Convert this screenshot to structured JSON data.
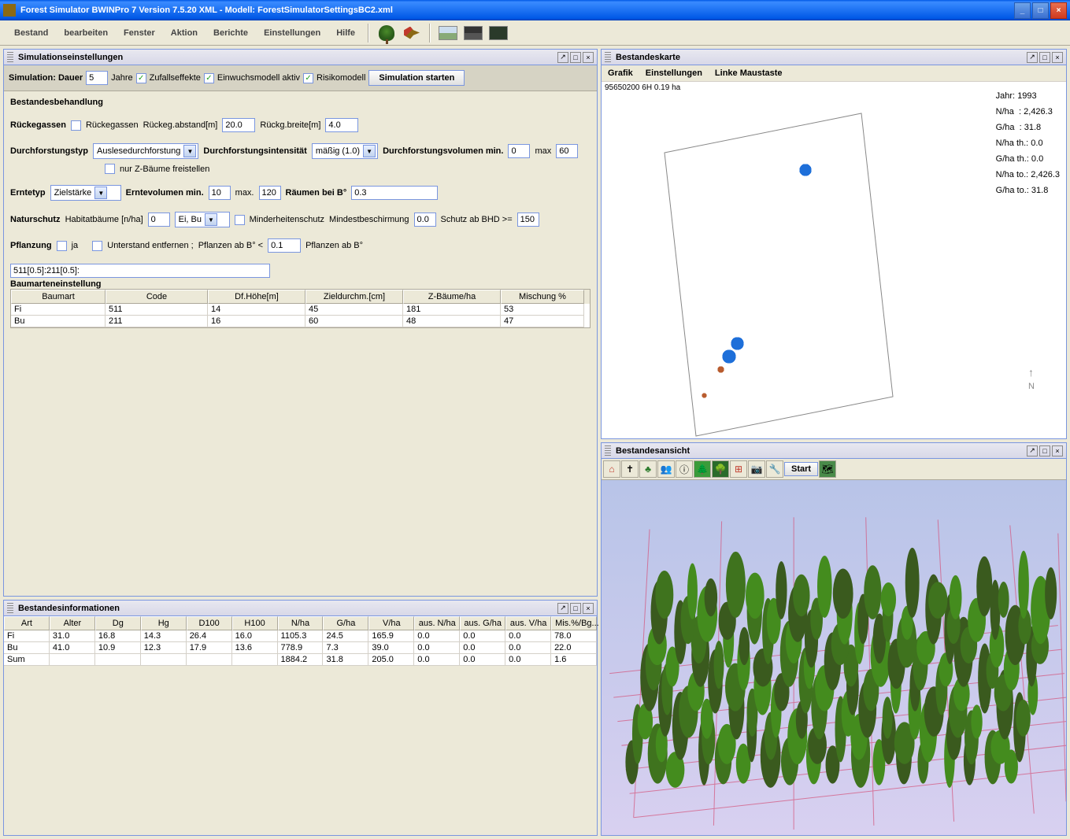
{
  "window": {
    "title": "Forest Simulator BWINPro 7 Version 7.5.20 XML - Modell: ForestSimulatorSettingsBC2.xml"
  },
  "menu": {
    "items": [
      "Bestand",
      "bearbeiten",
      "Fenster",
      "Aktion",
      "Berichte",
      "Einstellungen",
      "Hilfe"
    ]
  },
  "panels": {
    "settings": {
      "title": "Simulationseinstellungen"
    },
    "info": {
      "title": "Bestandesinformationen"
    },
    "map": {
      "title": "Bestandeskarte"
    },
    "view": {
      "title": "Bestandesansicht"
    }
  },
  "sim": {
    "duration_label": "Simulation: Dauer",
    "duration": "5",
    "years": "Jahre",
    "random_label": "Zufallseffekte",
    "ingrowth_label": "Einwuchsmodell aktiv",
    "risk_label": "Risikomodell",
    "start_btn": "Simulation starten"
  },
  "treatment": {
    "heading": "Bestandesbehandlung",
    "skid_label": "Rückegassen",
    "skid_chk": "Rückegassen",
    "skid_dist_label": "Rückeg.abstand[m]",
    "skid_dist": "20.0",
    "skid_width_label": "Rückg.breite[m]",
    "skid_width": "4.0",
    "thin_type_label": "Durchforstungstyp",
    "thin_type": "Auslesedurchforstung",
    "thin_int_label": "Durchforstungsintensität",
    "thin_int": "mäßig (1.0)",
    "thin_vol_label": "Durchforstungsvolumen min.",
    "thin_vol_min": "0",
    "thin_vol_max_label": "max",
    "thin_vol_max": "60",
    "only_z_label": "nur Z-Bäume freistellen",
    "harvest_type_label": "Erntetyp",
    "harvest_type": "Zielstärke",
    "harvest_vol_label": "Erntevolumen min.",
    "harvest_vol_min": "10",
    "harvest_vol_max_label": "max.",
    "harvest_vol_max": "120",
    "clear_label": "Räumen bei B°",
    "clear_val": "0.3",
    "nature_label": "Naturschutz",
    "habitat_label": "Habitatbäume [n/ha]",
    "habitat_val": "0",
    "species_sel": "Ei, Bu",
    "minority_label": "Minderheitenschutz",
    "cover_label": "Mindestbeschirmung",
    "cover_val": "0.0",
    "protect_label": "Schutz ab BHD >=",
    "protect_val": "150",
    "plant_label": "Pflanzung",
    "plant_yes": "ja",
    "understory_label": "Unterstand entfernen ;",
    "plant_from_label": "Pflanzen ab B°  <",
    "plant_from_val": "0.1",
    "plant_from2_label": "Pflanzen ab B°",
    "plant_code": "511[0.5]:211[0.5]:",
    "species_heading": "Baumarteneinstellung"
  },
  "species_table": {
    "headers": [
      "Baumart",
      "Code",
      "Df.Höhe[m]",
      "Zieldurchm.[cm]",
      "Z-Bäume/ha",
      "Mischung %"
    ],
    "rows": [
      [
        "Fi",
        "511",
        "14",
        "45",
        "181",
        "53"
      ],
      [
        "Bu",
        "211",
        "16",
        "60",
        "48",
        "47"
      ]
    ]
  },
  "info_table": {
    "headers": [
      "Art",
      "Alter",
      "Dg",
      "Hg",
      "D100",
      "H100",
      "N/ha",
      "G/ha",
      "V/ha",
      "aus. N/ha",
      "aus. G/ha",
      "aus. V/ha",
      "Mis.%/Bg..."
    ],
    "rows": [
      [
        "Fi",
        "31.0",
        "16.8",
        "14.3",
        "26.4",
        "16.0",
        "1105.3",
        "24.5",
        "165.9",
        "0.0",
        "0.0",
        "0.0",
        "78.0"
      ],
      [
        "Bu",
        "41.0",
        "10.9",
        "12.3",
        "17.9",
        "13.6",
        "778.9",
        "7.3",
        "39.0",
        "0.0",
        "0.0",
        "0.0",
        "22.0"
      ],
      [
        "Sum",
        "",
        "",
        "",
        "",
        "",
        "1884.2",
        "31.8",
        "205.0",
        "0.0",
        "0.0",
        "0.0",
        "1.6"
      ]
    ]
  },
  "map": {
    "menu": [
      "Grafik",
      "Einstellungen",
      "Linke Maustaste"
    ],
    "id": "95650200 6H  0.19 ha",
    "stats": {
      "year_l": "Jahr:",
      "year": "1993",
      "nha_l": "N/ha",
      "nha": ": 2,426.3",
      "gha_l": "G/ha",
      "gha": ": 31.8",
      "nhath_l": "N/ha th.:",
      "nhath": "0.0",
      "ghath_l": "G/ha th.:",
      "ghath": "0.0",
      "nhato_l": "N/ha to.:",
      "nhato": "2,426.3",
      "ghato_l": "G/ha to.:",
      "ghato": "31.8"
    },
    "compass": "N"
  },
  "view": {
    "start": "Start"
  },
  "chart_data": {
    "type": "table",
    "title": "Bestandesinformationen",
    "columns": [
      "Art",
      "Alter",
      "Dg",
      "Hg",
      "D100",
      "H100",
      "N/ha",
      "G/ha",
      "V/ha",
      "aus. N/ha",
      "aus. G/ha",
      "aus. V/ha",
      "Mis.%/Bg"
    ],
    "rows": [
      {
        "Art": "Fi",
        "Alter": 31.0,
        "Dg": 16.8,
        "Hg": 14.3,
        "D100": 26.4,
        "H100": 16.0,
        "N/ha": 1105.3,
        "G/ha": 24.5,
        "V/ha": 165.9,
        "aus. N/ha": 0.0,
        "aus. G/ha": 0.0,
        "aus. V/ha": 0.0,
        "Mis.%/Bg": 78.0
      },
      {
        "Art": "Bu",
        "Alter": 41.0,
        "Dg": 10.9,
        "Hg": 12.3,
        "D100": 17.9,
        "H100": 13.6,
        "N/ha": 778.9,
        "G/ha": 7.3,
        "V/ha": 39.0,
        "aus. N/ha": 0.0,
        "aus. G/ha": 0.0,
        "aus. V/ha": 0.0,
        "Mis.%/Bg": 22.0
      },
      {
        "Art": "Sum",
        "N/ha": 1884.2,
        "G/ha": 31.8,
        "V/ha": 205.0,
        "aus. N/ha": 0.0,
        "aus. G/ha": 0.0,
        "aus. V/ha": 0.0,
        "Mis.%/Bg": 1.6
      }
    ]
  }
}
